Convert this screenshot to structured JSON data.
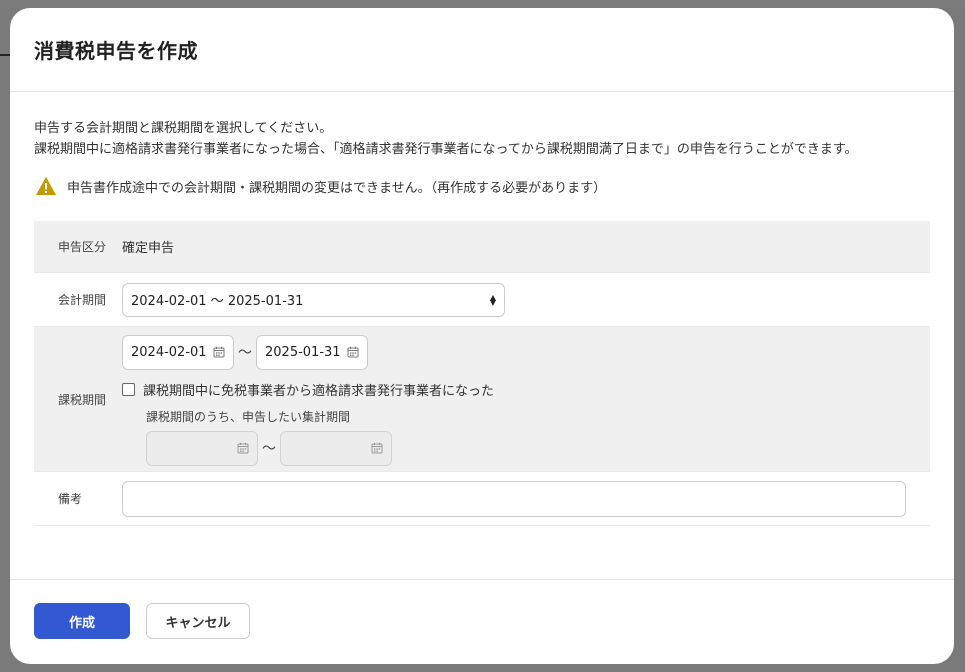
{
  "dialog": {
    "title": "消費税申告を作成",
    "description_line1": "申告する会計期間と課税期間を選択してください。",
    "description_line2": "課税期間中に適格請求書発行事業者になった場合、「適格請求書発行事業者になってから課税期間満了日まで」の申告を行うことができます。",
    "warning": "申告書作成途中での会計期間・課税期間の変更はできません。（再作成する必要があります）",
    "warning_icon": "warning-triangle-icon",
    "warning_color": "#c59a00"
  },
  "form": {
    "kubun": {
      "label": "申告区分",
      "value": "確定申告"
    },
    "kaikei": {
      "label": "会計期間",
      "selected": "2024-02-01 〜 2025-01-31"
    },
    "kazei": {
      "label": "課税期間",
      "start": "2024-02-01",
      "end": "2025-01-31",
      "separator": "〜",
      "checkbox_label": "課税期間中に免税事業者から適格請求書発行事業者になった",
      "checked": false,
      "sub_label": "課税期間のうち、申告したい集計期間",
      "sub_start": "",
      "sub_end": ""
    },
    "biko": {
      "label": "備考",
      "value": ""
    }
  },
  "footer": {
    "create_label": "作成",
    "cancel_label": "キャンセル",
    "primary_color": "#3358d4"
  }
}
